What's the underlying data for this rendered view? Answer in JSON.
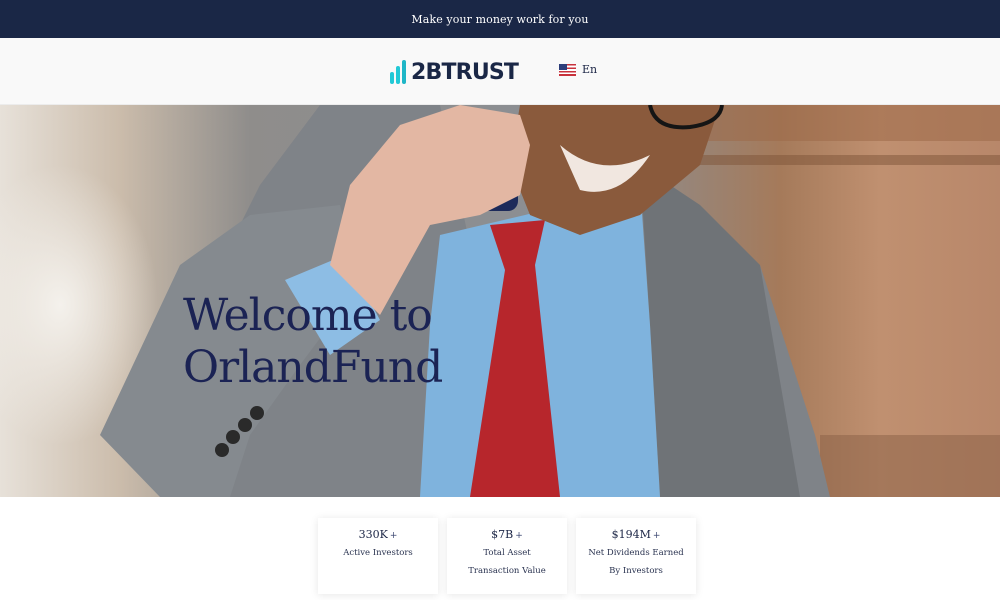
{
  "topbar": {
    "tagline": "Make your money work for you"
  },
  "header": {
    "logo_text": "2BTRUST",
    "language": {
      "label": "En",
      "flag_icon": "us-flag-icon"
    }
  },
  "hero": {
    "title_line1": "Welcome to",
    "title_line2": "OrlandFund"
  },
  "stats": [
    {
      "value": "330K",
      "suffix": "+",
      "label": "Active Investors"
    },
    {
      "value": "$7B",
      "suffix": "+",
      "label": "Total Asset Transaction Value"
    },
    {
      "value": "$194M",
      "suffix": "+",
      "label": "Net Dividends Earned By Investors"
    }
  ],
  "colors": {
    "navy": "#1a2746",
    "accent": "#22c9d6",
    "hero_title": "#1b2354"
  }
}
